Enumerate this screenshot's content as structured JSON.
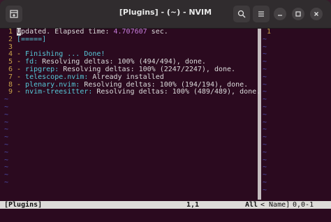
{
  "window": {
    "title": "[Plugins] - (~) - NVIM"
  },
  "left_pane": {
    "lines": [
      {
        "n": "1",
        "parts": [
          {
            "t": "U",
            "c": "cursor"
          },
          {
            "t": "pdated. Elapsed time: ",
            "c": ""
          },
          {
            "t": "4.707607",
            "c": "hl-magenta"
          },
          {
            "t": " sec.",
            "c": ""
          }
        ]
      },
      {
        "n": "2",
        "parts": [
          {
            "t": "[=====]",
            "c": "hl-cyan"
          }
        ]
      },
      {
        "n": "3",
        "parts": []
      },
      {
        "n": "4",
        "parts": [
          {
            "t": "- ",
            "c": "hl-yellow"
          },
          {
            "t": "Finishing ... Done!",
            "c": "hl-cyan"
          }
        ]
      },
      {
        "n": "5",
        "parts": [
          {
            "t": "- ",
            "c": "hl-yellow"
          },
          {
            "t": "fd:",
            "c": "hl-cyan"
          },
          {
            "t": " Resolving deltas: 100% (494/494), done.",
            "c": ""
          }
        ]
      },
      {
        "n": "6",
        "parts": [
          {
            "t": "- ",
            "c": "hl-yellow"
          },
          {
            "t": "ripgrep:",
            "c": "hl-cyan"
          },
          {
            "t": " Resolving deltas: 100% (2247/2247), done.",
            "c": ""
          }
        ]
      },
      {
        "n": "7",
        "parts": [
          {
            "t": "- ",
            "c": "hl-yellow"
          },
          {
            "t": "telescope.nvim:",
            "c": "hl-cyan"
          },
          {
            "t": " Already installed",
            "c": ""
          }
        ]
      },
      {
        "n": "8",
        "parts": [
          {
            "t": "- ",
            "c": "hl-yellow"
          },
          {
            "t": "plenary.nvim:",
            "c": "hl-cyan"
          },
          {
            "t": " Resolving deltas: 100% (194/194), done.",
            "c": ""
          }
        ]
      },
      {
        "n": "9",
        "parts": [
          {
            "t": "- ",
            "c": "hl-yellow"
          },
          {
            "t": "nvim-treesitter:",
            "c": "hl-cyan"
          },
          {
            "t": " Resolving deltas: 100% (489/489), done.",
            "c": ""
          }
        ]
      }
    ],
    "tilde": "~",
    "tilde_rows": 12
  },
  "right_pane": {
    "line_number": "1",
    "tilde": "~",
    "tilde_rows": 21
  },
  "statusline": {
    "left": "[Plugins]",
    "position": "1,1",
    "scroll": "All",
    "right_name": "< Name]",
    "right_pos": "0,0-1"
  },
  "icons": {
    "new_tab": "new-tab-icon",
    "search": "search-icon",
    "menu": "hamburger-menu-icon",
    "minimize": "minimize-icon",
    "maximize": "maximize-icon",
    "close": "close-icon"
  }
}
